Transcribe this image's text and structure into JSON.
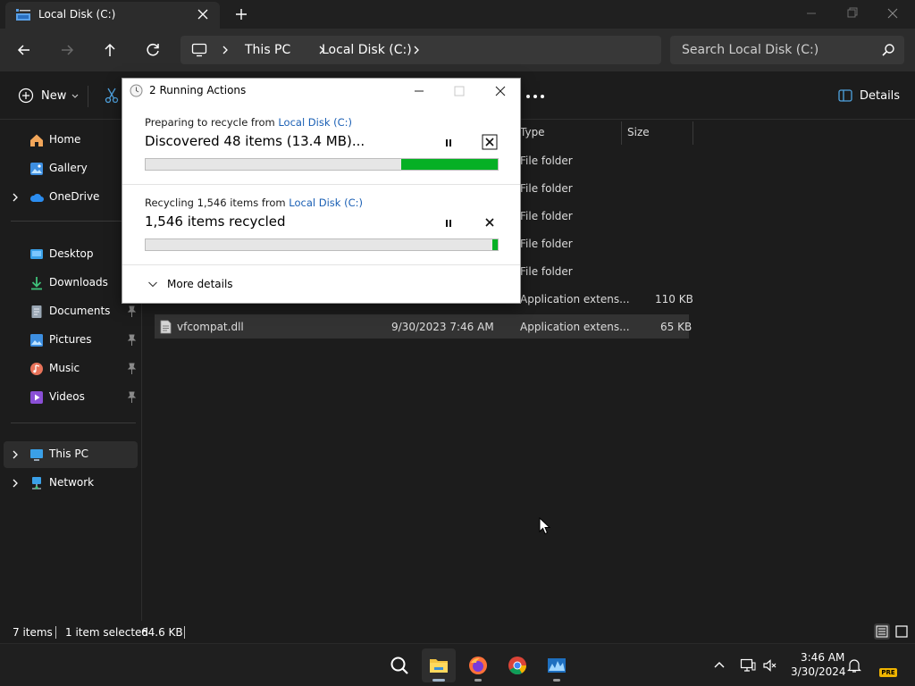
{
  "window": {
    "tab_title": "Local Disk (C:)"
  },
  "address": {
    "crumbs": [
      "This PC",
      "Local Disk (C:)"
    ],
    "search_placeholder": "Search Local Disk (C:)"
  },
  "toolbar": {
    "new_label": "New",
    "details_label": "Details"
  },
  "sidebar": {
    "items": [
      {
        "label": "Home",
        "icon": "home-icon"
      },
      {
        "label": "Gallery",
        "icon": "gallery-icon"
      },
      {
        "label": "OneDrive",
        "icon": "onedrive-icon"
      },
      {
        "label": "Desktop",
        "icon": "desktop-icon"
      },
      {
        "label": "Downloads",
        "icon": "downloads-icon"
      },
      {
        "label": "Documents",
        "icon": "documents-icon"
      },
      {
        "label": "Pictures",
        "icon": "pictures-icon"
      },
      {
        "label": "Music",
        "icon": "music-icon"
      },
      {
        "label": "Videos",
        "icon": "videos-icon"
      },
      {
        "label": "This PC",
        "icon": "this-pc-icon"
      },
      {
        "label": "Network",
        "icon": "network-icon"
      }
    ]
  },
  "columns": {
    "type": "Type",
    "size": "Size"
  },
  "rows": [
    {
      "type": "File folder",
      "size": ""
    },
    {
      "type": "File folder",
      "size": ""
    },
    {
      "type": "File folder",
      "size": ""
    },
    {
      "type": "File folder",
      "size": ""
    },
    {
      "type": "File folder",
      "size": ""
    },
    {
      "type": "Application extens...",
      "size": "110 KB"
    },
    {
      "name": "vfcompat.dll",
      "date": "9/30/2023 7:46 AM",
      "type": "Application extens...",
      "size": "65 KB"
    }
  ],
  "dialog": {
    "title": "2 Running Actions",
    "op1": {
      "head": "Preparing to recycle from ",
      "link": "Local Disk (C:)",
      "main": "Discovered 48 items (13.4 MB)...",
      "progress_start": 0.725,
      "progress_end": 1.0
    },
    "op2": {
      "head": "Recycling 1,546 items from ",
      "link": "Local Disk (C:)",
      "main": "1,546 items recycled",
      "progress_start": 0.985,
      "progress_end": 1.0
    },
    "more_details": "More details"
  },
  "status": {
    "count": "7 items",
    "selected": "1 item selected",
    "size": "64.6 KB"
  },
  "taskbar": {
    "time": "3:46 AM",
    "date": "3/30/2024",
    "badge": "PRE"
  }
}
